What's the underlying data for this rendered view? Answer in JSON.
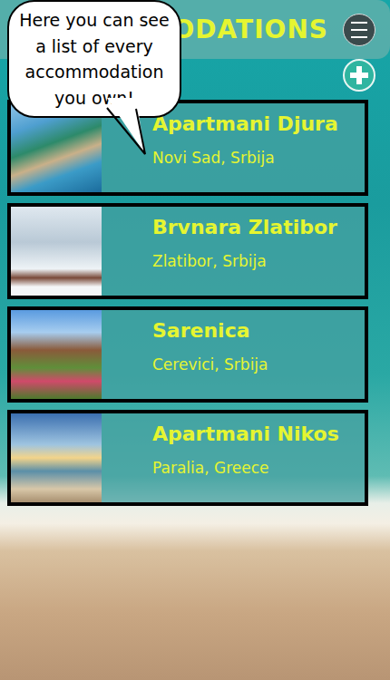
{
  "header": {
    "title": "MODATIONS"
  },
  "tooltip": "Here you can see a list of every accommodation you own!",
  "accommodations": [
    {
      "name": "Apartmani Djura",
      "location": "Novi Sad, Srbija",
      "picture": "beach-resort"
    },
    {
      "name": "Brvnara Zlatibor",
      "location": "Zlatibor, Srbija",
      "picture": "snow-cabin"
    },
    {
      "name": "Sarenica",
      "location": "Cerevici, Srbija",
      "picture": "village"
    },
    {
      "name": "Apartmani Nikos",
      "location": "Paralia, Greece",
      "picture": "sunset-beach"
    }
  ]
}
